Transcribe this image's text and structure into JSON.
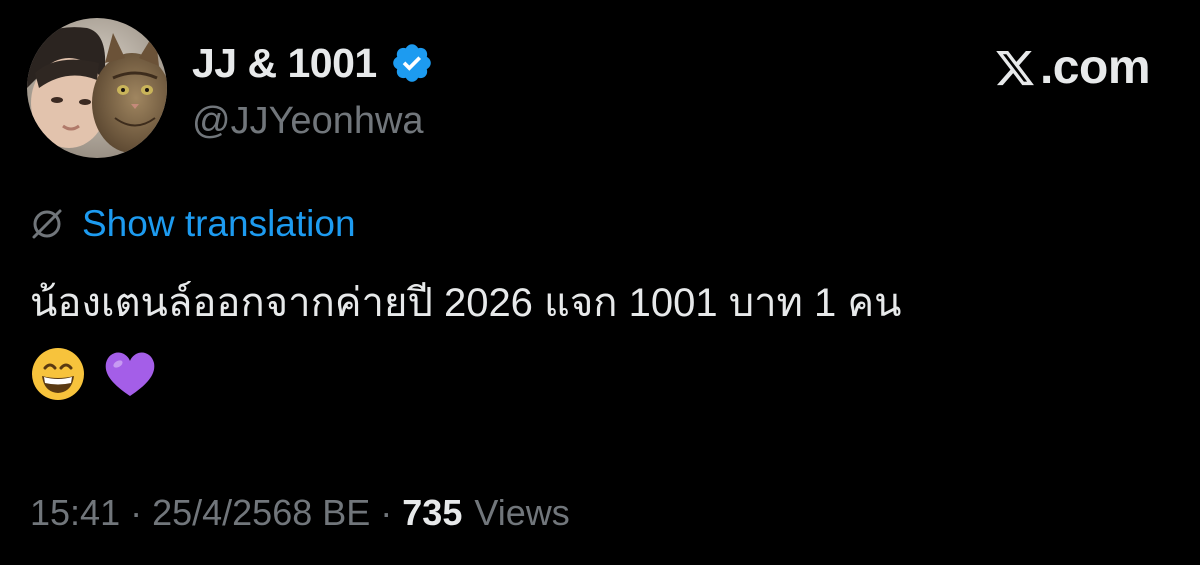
{
  "author": {
    "display_name": "JJ & 1001",
    "handle": "@JJYeonhwa",
    "verified": true,
    "avatar": "photo-person-with-cat"
  },
  "brand": {
    "icon": "x-logo-icon",
    "domain": ".com"
  },
  "translation": {
    "icon": "globe-icon",
    "label": "Show translation"
  },
  "tweet": {
    "text": "น้องเตนล์ออกจากค่ายปี 2026 แจก 1001 บาท 1 คน",
    "emojis": [
      "grinning-face-emoji",
      "purple-heart-emoji"
    ]
  },
  "meta": {
    "time": "15:41",
    "separator": "·",
    "date": "25/4/2568 BE",
    "views_count": "735",
    "views_label": "Views"
  },
  "colors": {
    "background": "#000000",
    "text_primary": "#e7e9ea",
    "text_secondary": "#71767b",
    "link": "#1d9bf0",
    "verified_badge": "#1d9bf0",
    "purple_heart": "#a45ee8",
    "emoji_yellow": "#f7c33c"
  }
}
